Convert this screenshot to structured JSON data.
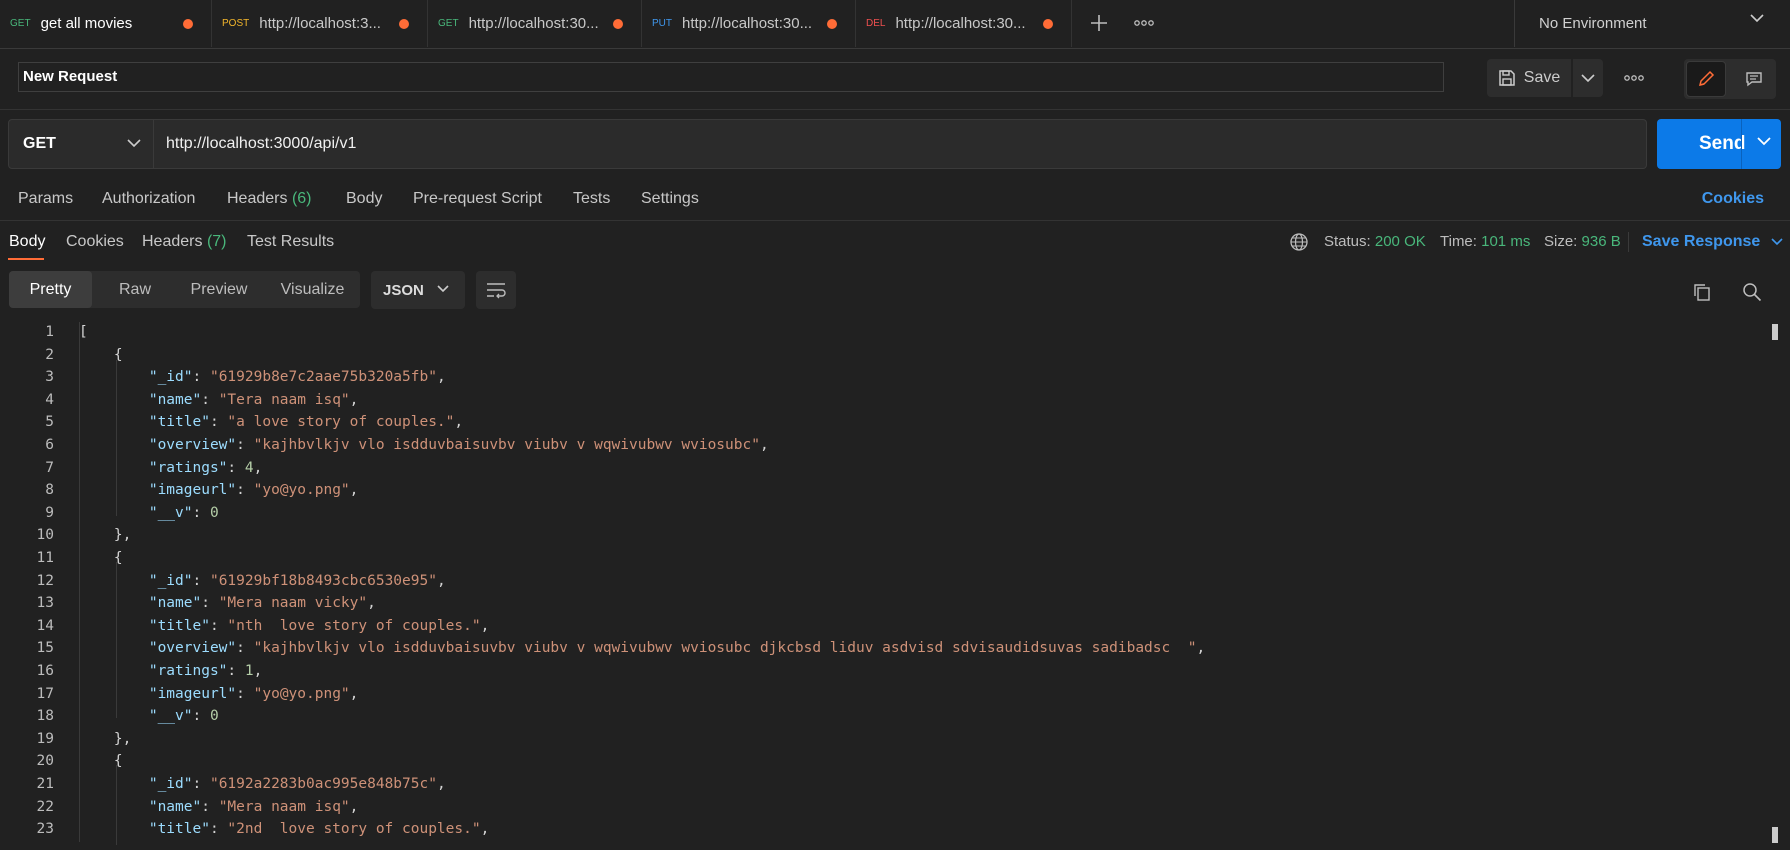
{
  "tabs": [
    {
      "method": "GET",
      "method_color": "#49b77b",
      "title": "get all movies",
      "active": true
    },
    {
      "method": "POST",
      "method_color": "#f2b52b",
      "title": "http://localhost:3...",
      "active": false
    },
    {
      "method": "GET",
      "method_color": "#49b77b",
      "title": "http://localhost:30...",
      "active": false
    },
    {
      "method": "PUT",
      "method_color": "#3f97ed",
      "title": "http://localhost:30...",
      "active": false
    },
    {
      "method": "DEL",
      "method_color": "#f05050",
      "title": "http://localhost:30...",
      "active": false
    }
  ],
  "environment": "No Environment",
  "request_name": "New Request",
  "save_label": "Save",
  "method": "GET",
  "url": "http://localhost:3000/api/v1",
  "send_label": "Send",
  "request_tabs": {
    "params": "Params",
    "authorization": "Authorization",
    "headers": "Headers",
    "headers_count": "(6)",
    "body": "Body",
    "prerequest": "Pre-request Script",
    "tests": "Tests",
    "settings": "Settings",
    "cookies": "Cookies"
  },
  "response_tabs": {
    "body": "Body",
    "cookies": "Cookies",
    "headers": "Headers",
    "headers_count": "(7)",
    "test_results": "Test Results"
  },
  "response_meta": {
    "status_label": "Status:",
    "status_value": "200 OK",
    "time_label": "Time:",
    "time_value": "101 ms",
    "size_label": "Size:",
    "size_value": "936 B",
    "save_response": "Save Response"
  },
  "view_modes": {
    "pretty": "Pretty",
    "raw": "Raw",
    "preview": "Preview",
    "visualize": "Visualize"
  },
  "format": "JSON",
  "code_lines": [
    {
      "n": "1",
      "indent": "",
      "parts": [
        [
          "p",
          "["
        ]
      ]
    },
    {
      "n": "2",
      "indent": "    ",
      "parts": [
        [
          "p",
          "{"
        ]
      ]
    },
    {
      "n": "3",
      "indent": "        ",
      "parts": [
        [
          "k",
          "\"_id\""
        ],
        [
          "p",
          ": "
        ],
        [
          "s",
          "\"61929b8e7c2aae75b320a5fb\""
        ],
        [
          "p",
          ","
        ]
      ]
    },
    {
      "n": "4",
      "indent": "        ",
      "parts": [
        [
          "k",
          "\"name\""
        ],
        [
          "p",
          ": "
        ],
        [
          "s",
          "\"Tera naam isq\""
        ],
        [
          "p",
          ","
        ]
      ]
    },
    {
      "n": "5",
      "indent": "        ",
      "parts": [
        [
          "k",
          "\"title\""
        ],
        [
          "p",
          ": "
        ],
        [
          "s",
          "\"a love story of couples.\""
        ],
        [
          "p",
          ","
        ]
      ]
    },
    {
      "n": "6",
      "indent": "        ",
      "parts": [
        [
          "k",
          "\"overview\""
        ],
        [
          "p",
          ": "
        ],
        [
          "s",
          "\"kajhbvlkjv vlo isdduvbaisuvbv viubv v wqwivubwv wviosubc\""
        ],
        [
          "p",
          ","
        ]
      ]
    },
    {
      "n": "7",
      "indent": "        ",
      "parts": [
        [
          "k",
          "\"ratings\""
        ],
        [
          "p",
          ": "
        ],
        [
          "n",
          "4"
        ],
        [
          "p",
          ","
        ]
      ]
    },
    {
      "n": "8",
      "indent": "        ",
      "parts": [
        [
          "k",
          "\"imageurl\""
        ],
        [
          "p",
          ": "
        ],
        [
          "s",
          "\"yo@yo.png\""
        ],
        [
          "p",
          ","
        ]
      ]
    },
    {
      "n": "9",
      "indent": "        ",
      "parts": [
        [
          "k",
          "\"__v\""
        ],
        [
          "p",
          ": "
        ],
        [
          "n",
          "0"
        ]
      ]
    },
    {
      "n": "10",
      "indent": "    ",
      "parts": [
        [
          "p",
          "},"
        ]
      ]
    },
    {
      "n": "11",
      "indent": "    ",
      "parts": [
        [
          "p",
          "{"
        ]
      ]
    },
    {
      "n": "12",
      "indent": "        ",
      "parts": [
        [
          "k",
          "\"_id\""
        ],
        [
          "p",
          ": "
        ],
        [
          "s",
          "\"61929bf18b8493cbc6530e95\""
        ],
        [
          "p",
          ","
        ]
      ]
    },
    {
      "n": "13",
      "indent": "        ",
      "parts": [
        [
          "k",
          "\"name\""
        ],
        [
          "p",
          ": "
        ],
        [
          "s",
          "\"Mera naam vicky\""
        ],
        [
          "p",
          ","
        ]
      ]
    },
    {
      "n": "14",
      "indent": "        ",
      "parts": [
        [
          "k",
          "\"title\""
        ],
        [
          "p",
          ": "
        ],
        [
          "s",
          "\"nth  love story of couples.\""
        ],
        [
          "p",
          ","
        ]
      ]
    },
    {
      "n": "15",
      "indent": "        ",
      "parts": [
        [
          "k",
          "\"overview\""
        ],
        [
          "p",
          ": "
        ],
        [
          "s",
          "\"kajhbvlkjv vlo isdduvbaisuvbv viubv v wqwivubwv wviosubc djkcbsd liduv asdvisd sdvisaudidsuvas sadibadsc  \""
        ],
        [
          "p",
          ","
        ]
      ]
    },
    {
      "n": "16",
      "indent": "        ",
      "parts": [
        [
          "k",
          "\"ratings\""
        ],
        [
          "p",
          ": "
        ],
        [
          "n",
          "1"
        ],
        [
          "p",
          ","
        ]
      ]
    },
    {
      "n": "17",
      "indent": "        ",
      "parts": [
        [
          "k",
          "\"imageurl\""
        ],
        [
          "p",
          ": "
        ],
        [
          "s",
          "\"yo@yo.png\""
        ],
        [
          "p",
          ","
        ]
      ]
    },
    {
      "n": "18",
      "indent": "        ",
      "parts": [
        [
          "k",
          "\"__v\""
        ],
        [
          "p",
          ": "
        ],
        [
          "n",
          "0"
        ]
      ]
    },
    {
      "n": "19",
      "indent": "    ",
      "parts": [
        [
          "p",
          "},"
        ]
      ]
    },
    {
      "n": "20",
      "indent": "    ",
      "parts": [
        [
          "p",
          "{"
        ]
      ]
    },
    {
      "n": "21",
      "indent": "        ",
      "parts": [
        [
          "k",
          "\"_id\""
        ],
        [
          "p",
          ": "
        ],
        [
          "s",
          "\"6192a2283b0ac995e848b75c\""
        ],
        [
          "p",
          ","
        ]
      ]
    },
    {
      "n": "22",
      "indent": "        ",
      "parts": [
        [
          "k",
          "\"name\""
        ],
        [
          "p",
          ": "
        ],
        [
          "s",
          "\"Mera naam isq\""
        ],
        [
          "p",
          ","
        ]
      ]
    },
    {
      "n": "23",
      "indent": "        ",
      "parts": [
        [
          "k",
          "\"title\""
        ],
        [
          "p",
          ": "
        ],
        [
          "s",
          "\"2nd  love story of couples.\""
        ],
        [
          "p",
          ","
        ]
      ]
    }
  ]
}
